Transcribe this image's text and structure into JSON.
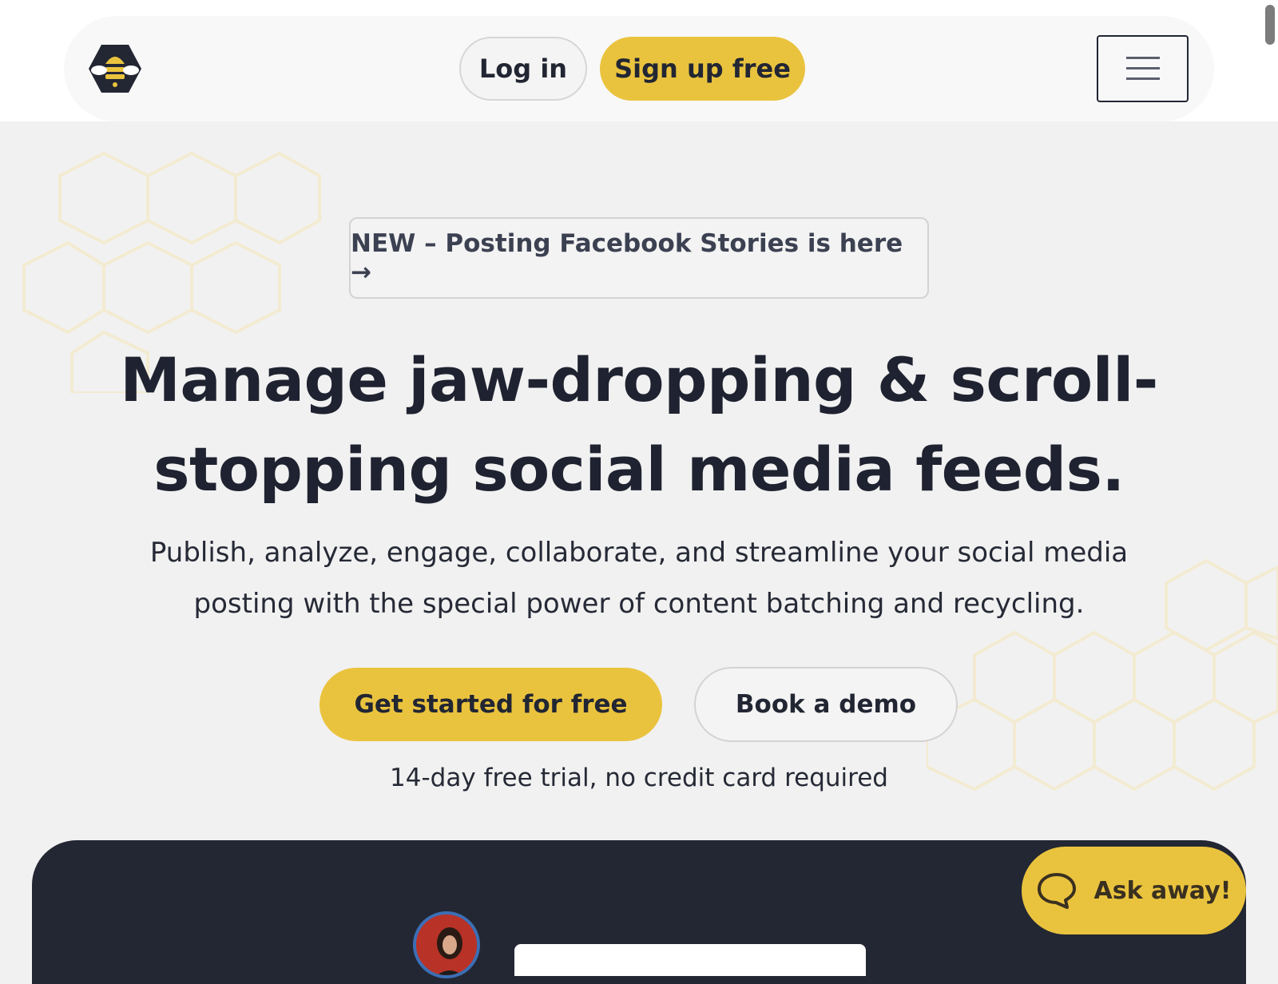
{
  "header": {
    "login_label": "Log in",
    "signup_label": "Sign up free"
  },
  "announcement": {
    "text": "NEW – Posting Facebook Stories is here →"
  },
  "hero": {
    "headline": "Manage jaw-dropping & scroll-stopping social media feeds.",
    "subtext": "Publish, analyze, engage, collaborate, and streamline your social media posting with the special power of content batching and recycling.",
    "primary_cta": "Get started for free",
    "secondary_cta": "Book a demo",
    "trial_note": "14-day free trial, no credit card required"
  },
  "chat": {
    "label": "Ask away!"
  },
  "icons": {
    "logo": "bee-logo-icon",
    "menu": "hamburger-menu-icon",
    "chat": "chat-bubble-icon"
  },
  "colors": {
    "brand_yellow": "#eac33e",
    "dark_navy": "#232733",
    "page_background": "#f1f1f1"
  }
}
